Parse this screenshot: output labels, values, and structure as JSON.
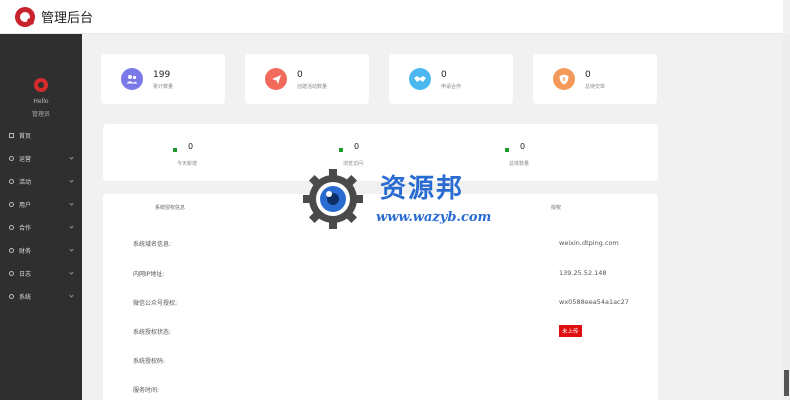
{
  "header": {
    "title": "管理后台"
  },
  "sidebar": {
    "user_name": "Hello",
    "user_role": "管理员",
    "items": [
      {
        "label": "首页",
        "icon": "grid-icon",
        "chevron": false
      },
      {
        "label": "运营",
        "icon": "circle-icon",
        "chevron": true
      },
      {
        "label": "活动",
        "icon": "circle-icon",
        "chevron": true
      },
      {
        "label": "用户",
        "icon": "circle-icon",
        "chevron": true
      },
      {
        "label": "合作",
        "icon": "circle-icon",
        "chevron": true
      },
      {
        "label": "财务",
        "icon": "circle-icon",
        "chevron": true
      },
      {
        "label": "日志",
        "icon": "circle-icon",
        "chevron": true
      },
      {
        "label": "系统",
        "icon": "circle-icon",
        "chevron": true
      }
    ]
  },
  "stats": [
    {
      "value": "199",
      "label": "累计数量",
      "color": "#7b78e8",
      "icon": "users-icon"
    },
    {
      "value": "0",
      "label": "创建活动数量",
      "color": "#f26a5b",
      "icon": "send-icon"
    },
    {
      "value": "0",
      "label": "申请合作",
      "color": "#4ab8ef",
      "icon": "handshake-icon"
    },
    {
      "value": "0",
      "label": "总待交单",
      "color": "#f39a5a",
      "icon": "shield-icon"
    }
  ],
  "metrics": [
    {
      "value": "0",
      "label": "今天新增"
    },
    {
      "value": "0",
      "label": "浏览访问"
    },
    {
      "value": "0",
      "label": "总体数量"
    }
  ],
  "info_table": {
    "col1_header": "系统授权信息",
    "col2_header": "授权",
    "rows": [
      {
        "label": "系统域名信息:",
        "value": "weixin.dtping.com"
      },
      {
        "label": "内网IP地址:",
        "value": "139.25.52.148"
      },
      {
        "label": "微信公众号授权:",
        "value": "wx0588eea54a1ac27"
      },
      {
        "label": "系统授权状态:",
        "value": "未上传",
        "badge": true
      },
      {
        "label": "系统授权码:",
        "value": ""
      },
      {
        "label": "服务时间:",
        "value": ""
      }
    ]
  },
  "watermark": {
    "cn": "资源邦",
    "url": "www.wazyb.com",
    "color": "#2a6bd1"
  }
}
